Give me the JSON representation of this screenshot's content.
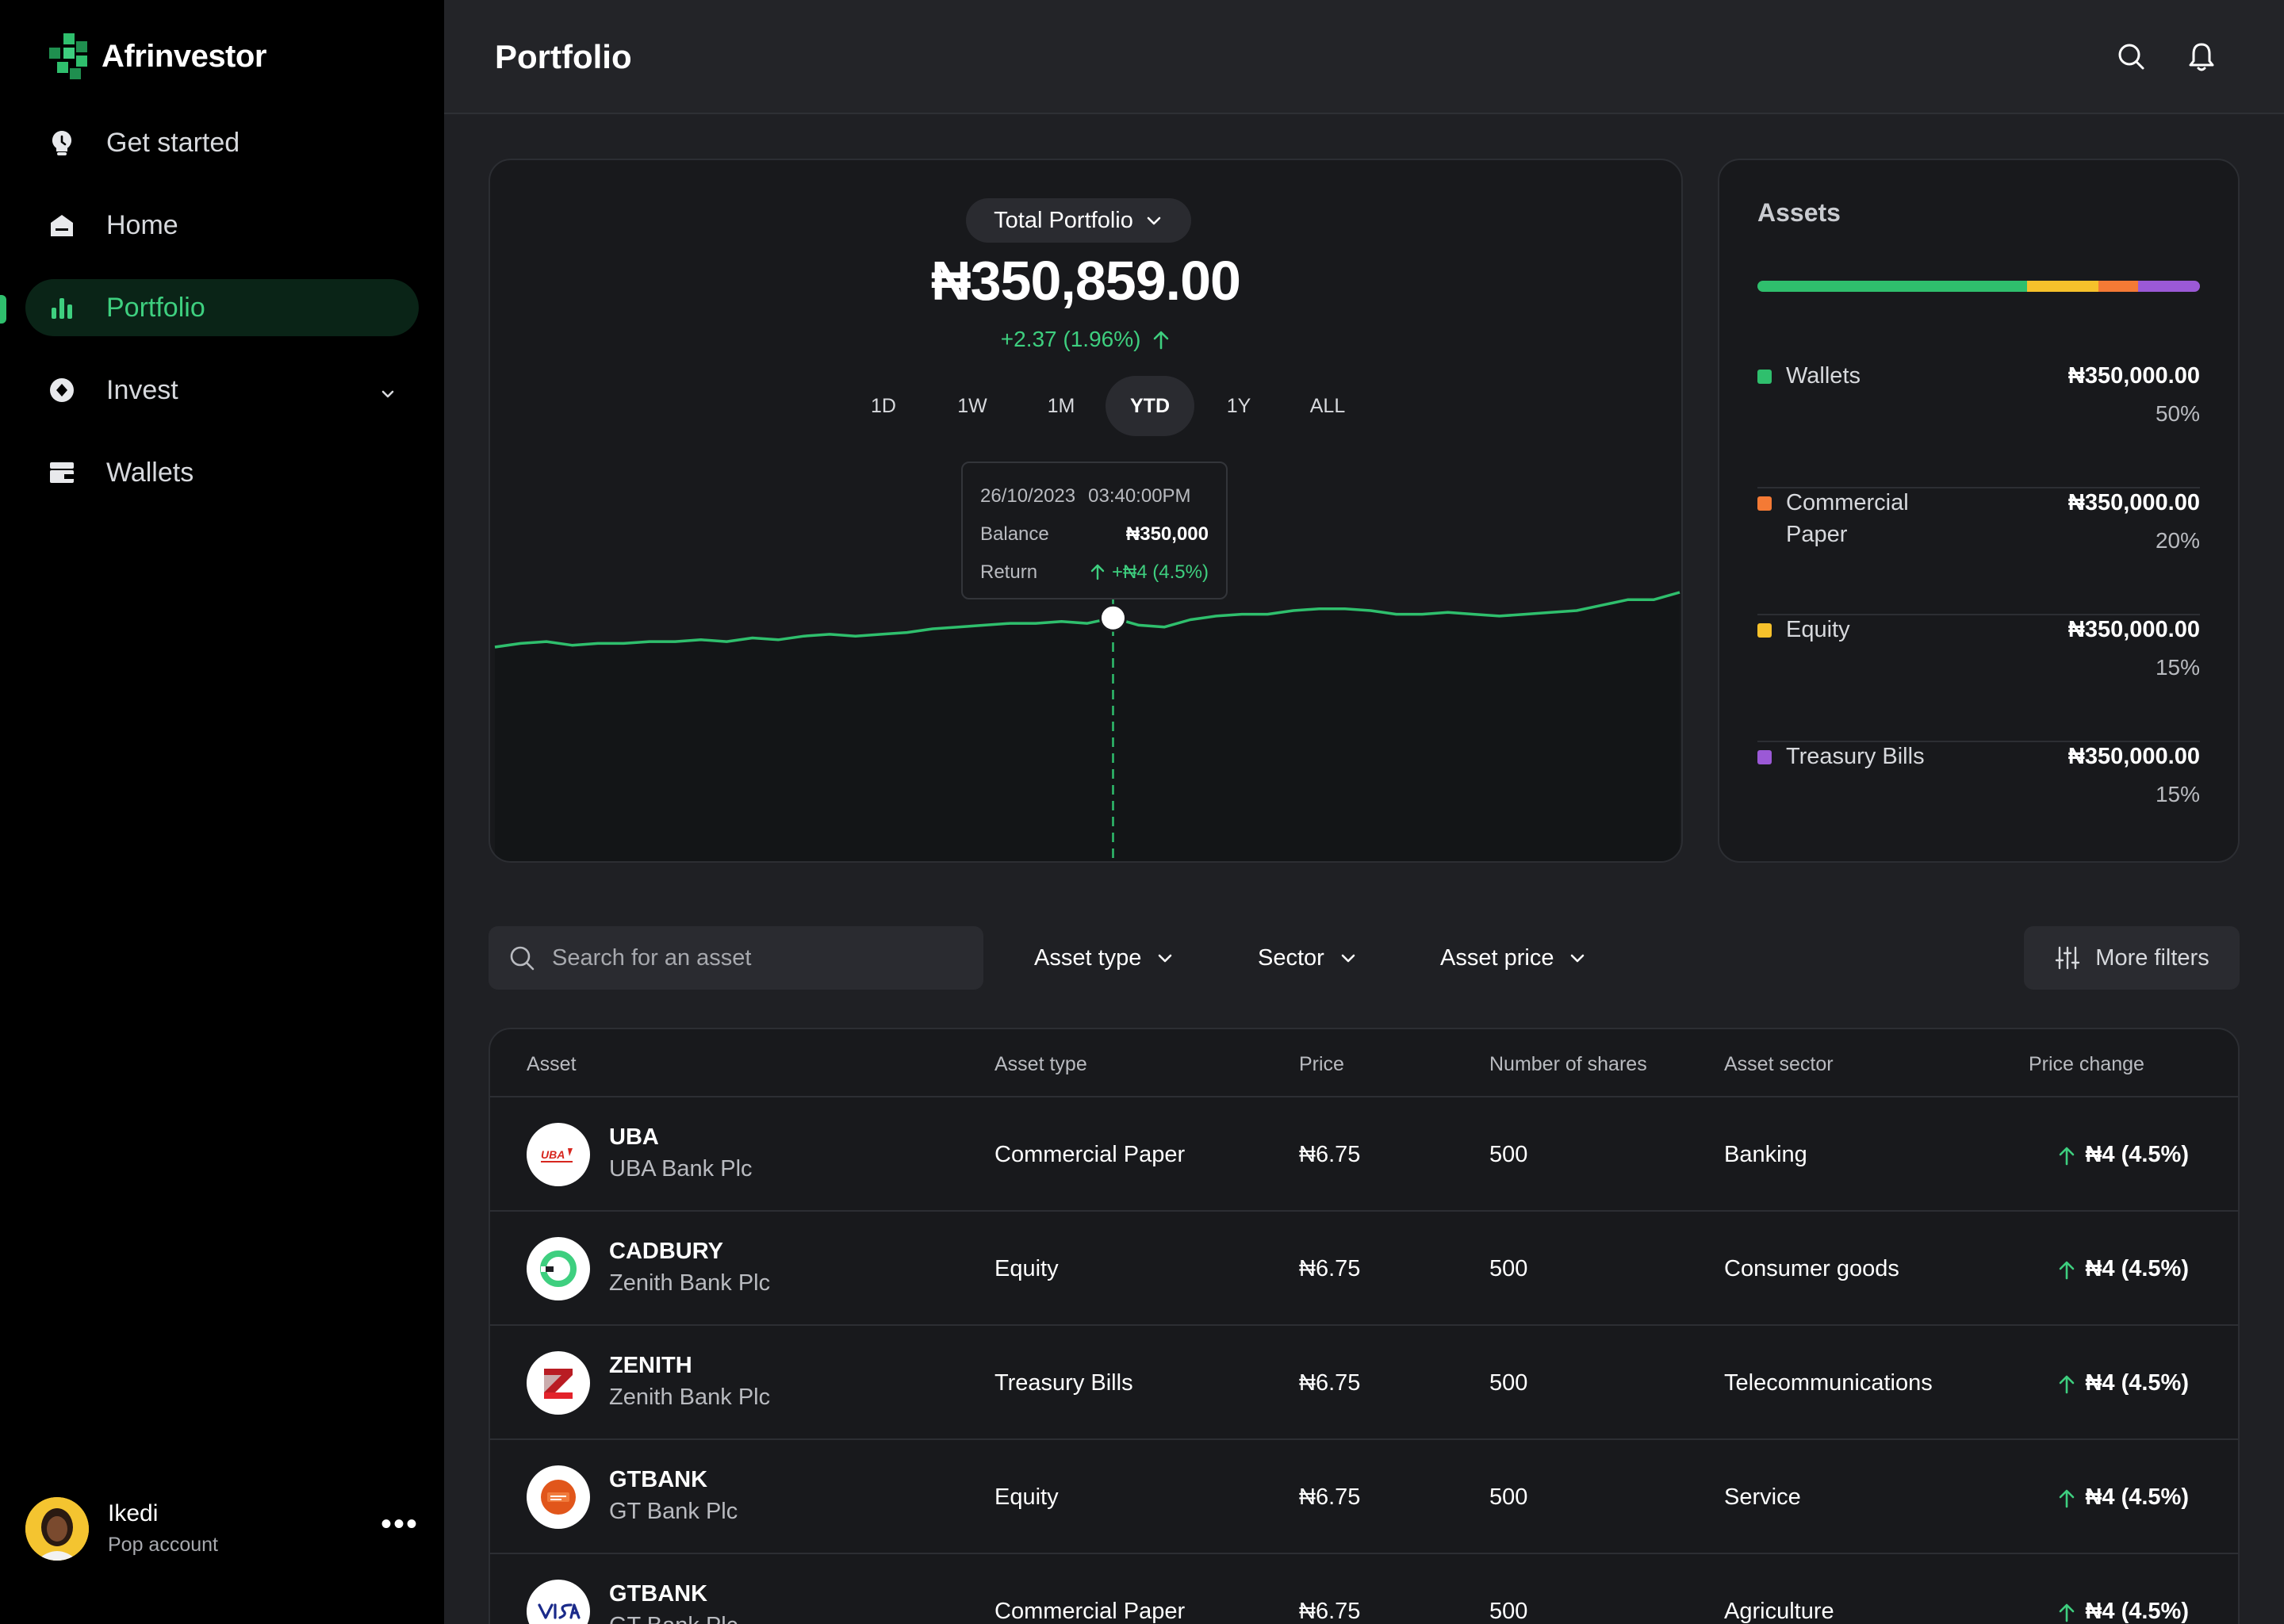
{
  "app": {
    "brand": "Afrinvestor",
    "page_title": "Portfolio"
  },
  "sidebar": {
    "items": [
      {
        "label": "Get started",
        "icon": "lightbulb-icon"
      },
      {
        "label": "Home",
        "icon": "home-icon"
      },
      {
        "label": "Portfolio",
        "icon": "bar-chart-icon",
        "active": true
      },
      {
        "label": "Invest",
        "icon": "compass-icon",
        "has_submenu": true
      },
      {
        "label": "Wallets",
        "icon": "wallet-icon"
      }
    ],
    "profile": {
      "name": "Ikedi",
      "subtitle": "Pop account",
      "more": "•••"
    }
  },
  "header": {
    "icons": [
      "search-icon",
      "bell-icon"
    ]
  },
  "portfolio": {
    "selector": "Total Portfolio",
    "total": "₦350,859.00",
    "change": "+2.37 (1.96%)",
    "ranges": [
      "1D",
      "1W",
      "1M",
      "YTD",
      "1Y",
      "ALL"
    ],
    "active_range": "YTD",
    "tooltip": {
      "date": "26/10/2023",
      "time": "03:40:00PM",
      "balance_label": "Balance",
      "balance_value": "₦350,000",
      "return_label": "Return",
      "return_value": "+₦4 (4.5%)"
    }
  },
  "chart_data": {
    "type": "area",
    "title": "",
    "xlabel": "",
    "ylabel": "",
    "series": [
      {
        "values": [
          20,
          22,
          23,
          21,
          22,
          22,
          23,
          23,
          24,
          23,
          25,
          24,
          26,
          27,
          26,
          27,
          28,
          30,
          31,
          32,
          33,
          33,
          34,
          33,
          36,
          32,
          31,
          35,
          37,
          38,
          38,
          40,
          41,
          41,
          40,
          38,
          38,
          39,
          38,
          37,
          38,
          39,
          40,
          43,
          46,
          46,
          50
        ]
      }
    ],
    "highlight_index": 24,
    "color": "#2fbf6d"
  },
  "assets": {
    "title": "Assets",
    "allocation_bar": [
      {
        "name": "Wallets",
        "fraction": 0.61,
        "color": "#2fbf6d"
      },
      {
        "name": "Equity",
        "fraction": 0.16,
        "color": "#f6c12b"
      },
      {
        "name": "Commercial Paper",
        "fraction": 0.09,
        "color": "#f47a35"
      },
      {
        "name": "Treasury Bills",
        "fraction": 0.14,
        "color": "#9b59d6"
      }
    ],
    "items": [
      {
        "name": "Wallets",
        "amount": "₦350,000.00",
        "percent": "50%",
        "color": "#2fbf6d"
      },
      {
        "name": "Commercial Paper",
        "amount": "₦350,000.00",
        "percent": "20%",
        "color": "#f47a35"
      },
      {
        "name": "Equity",
        "amount": "₦350,000.00",
        "percent": "15%",
        "color": "#f6c12b"
      },
      {
        "name": "Treasury Bills",
        "amount": "₦350,000.00",
        "percent": "15%",
        "color": "#9b59d6"
      }
    ]
  },
  "filters": {
    "search_placeholder": "Search for an asset",
    "asset_type": "Asset type",
    "sector": "Sector",
    "asset_price": "Asset price",
    "more": "More filters"
  },
  "table": {
    "columns": [
      "Asset",
      "Asset type",
      "Price",
      "Number of shares",
      "Asset sector",
      "Price change"
    ],
    "rows": [
      {
        "ticker": "UBA",
        "company": "UBA Bank Plc",
        "logo": "uba-logo",
        "type": "Commercial Paper",
        "price": "₦6.75",
        "shares": "500",
        "sector": "Banking",
        "change": "₦4 (4.5%)"
      },
      {
        "ticker": "CADBURY",
        "company": "Zenith Bank Plc",
        "logo": "cadbury-logo",
        "type": "Equity",
        "price": "₦6.75",
        "shares": "500",
        "sector": "Consumer goods",
        "change": "₦4 (4.5%)"
      },
      {
        "ticker": "ZENITH",
        "company": "Zenith Bank Plc",
        "logo": "zenith-logo",
        "type": "Treasury Bills",
        "price": "₦6.75",
        "shares": "500",
        "sector": "Telecommunications",
        "change": "₦4 (4.5%)"
      },
      {
        "ticker": "GTBANK",
        "company": "GT Bank Plc",
        "logo": "gtbank-logo",
        "type": "Equity",
        "price": "₦6.75",
        "shares": "500",
        "sector": "Service",
        "change": "₦4 (4.5%)"
      },
      {
        "ticker": "GTBANK",
        "company": "GT Bank Plc",
        "logo": "visa-logo",
        "type": "Commercial Paper",
        "price": "₦6.75",
        "shares": "500",
        "sector": "Agriculture",
        "change": "₦4 (4.5%)"
      }
    ]
  }
}
